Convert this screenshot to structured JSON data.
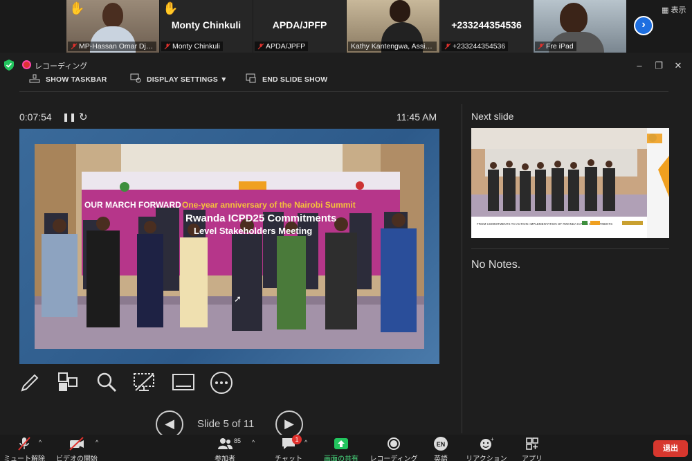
{
  "participants": [
    {
      "name": "MP-Hassan Omar Djib...",
      "type": "video",
      "hand_raised": true
    },
    {
      "name": "Monty Chinkuli",
      "display": "Monty Chinkuli",
      "type": "name",
      "hand_raised": true
    },
    {
      "name": "APDA/JPFP",
      "display": "APDA/JPFP",
      "type": "name",
      "hand_raised": false
    },
    {
      "name": "Kathy Kantengwa, Assista...",
      "type": "video",
      "hand_raised": false,
      "active": true
    },
    {
      "name": "+233244354536",
      "display": "+233244354536",
      "type": "name",
      "hand_raised": false
    },
    {
      "name": "Fre iPad",
      "type": "video",
      "hand_raised": false
    }
  ],
  "strip": {
    "view_label": "表示",
    "next_icon": "chevron-right-icon"
  },
  "recording": {
    "label": "レコーディング"
  },
  "toolbar": {
    "show_taskbar": "SHOW TASKBAR",
    "display_settings": "DISPLAY SETTINGS ▼",
    "end_slide_show": "END SLIDE SHOW"
  },
  "presenter": {
    "elapsed": "0:07:54",
    "clock": "11:45 AM",
    "slide_position": "Slide 5 of 11",
    "next_slide_label": "Next slide",
    "notes": "No Notes."
  },
  "slide_content": {
    "banner_top": "One-year anniversary of the Nairobi Summit",
    "banner_main": "Rwanda ICPD25 Commitments",
    "banner_sub": "Level Stakeholders Meeting",
    "left_text": "OUR MARCH FORWARD"
  },
  "next_slide_content": {
    "caption": "FROM COMMITMENTS TO ACTION: IMPLEMENTATION OF RWANDA ICPD25 COMMITMENTS"
  },
  "bottom_bar": {
    "unmute": "ミュート解除",
    "start_video": "ビデオの開始",
    "participants": "参加者",
    "participants_count": "85",
    "chat": "チャット",
    "chat_badge": "1",
    "share_screen": "画面の共有",
    "recording": "レコーディング",
    "language": "英語",
    "language_code": "EN",
    "reactions": "リアクション",
    "apps": "アプリ",
    "leave": "退出"
  },
  "colors": {
    "accent_green": "#22c55e",
    "leave_red": "#d7372e",
    "nav_blue": "#1e6fe0",
    "banner_magenta": "#b6368a"
  }
}
